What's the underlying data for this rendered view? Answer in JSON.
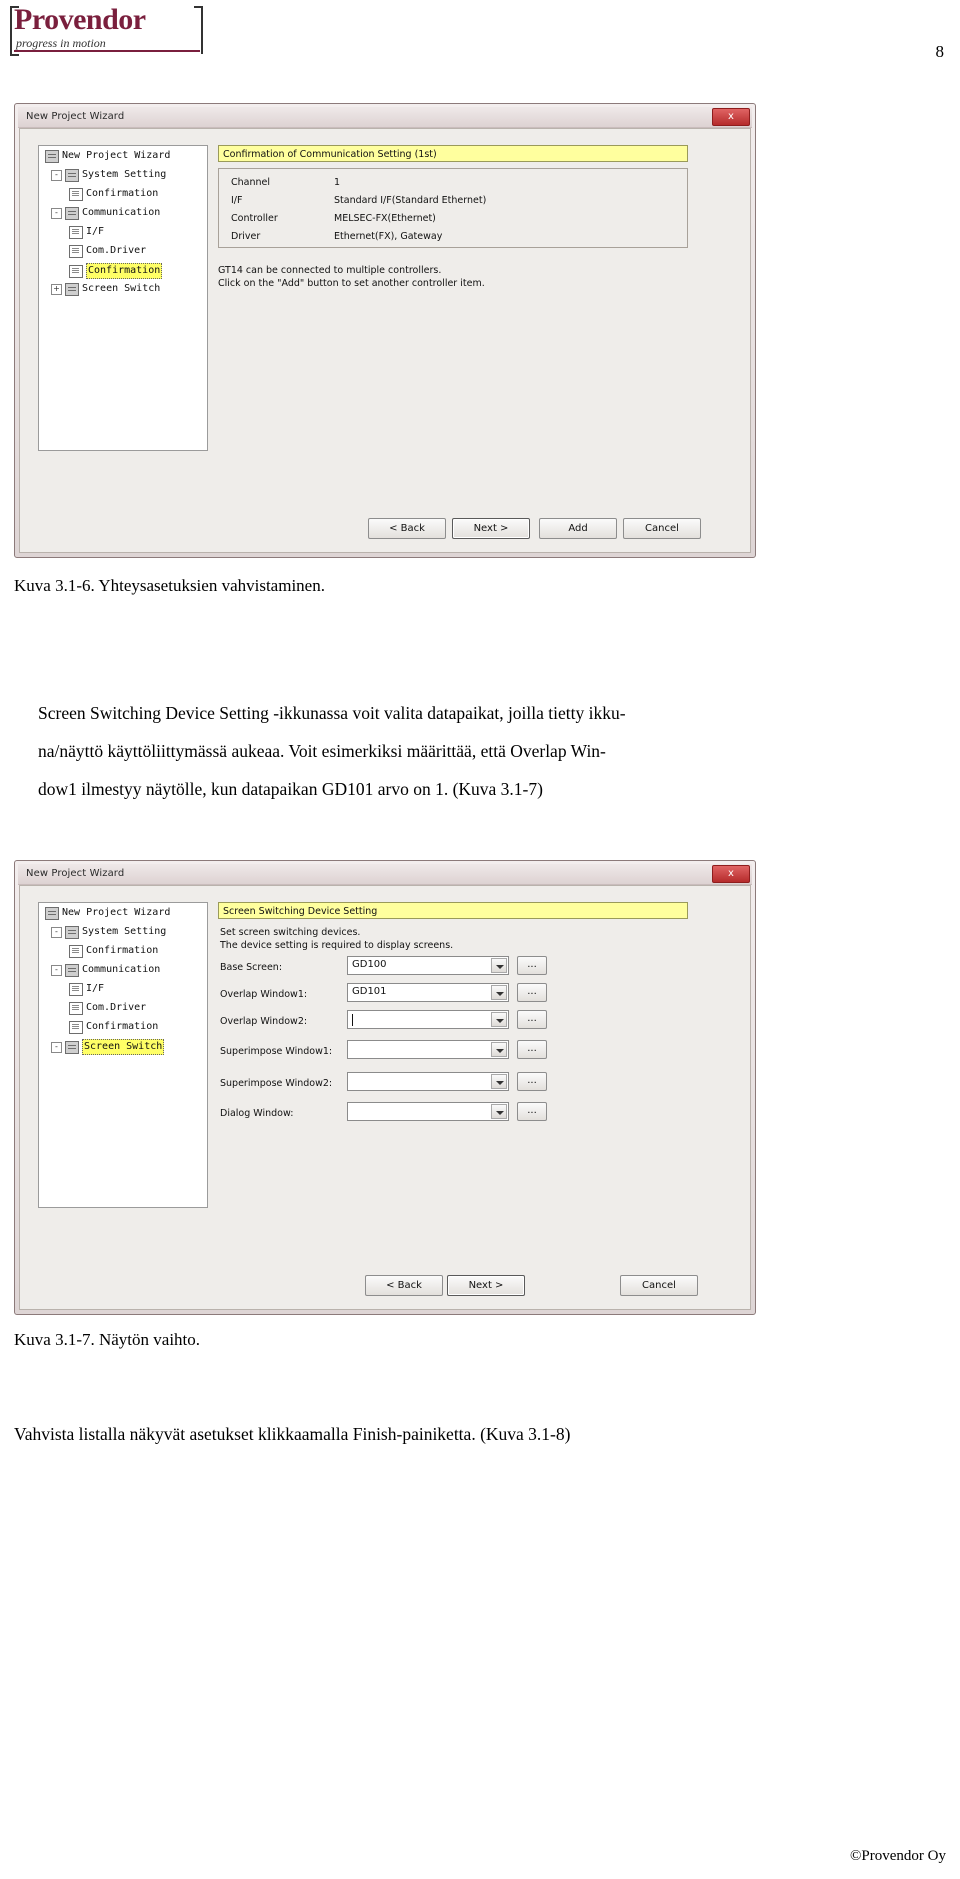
{
  "brand": {
    "name": "Provendor",
    "tagline": "progress in motion"
  },
  "page_number": "8",
  "footer": "©Provendor Oy",
  "dialog1": {
    "title": "New Project Wizard",
    "close_label": "x",
    "tree": [
      {
        "label": "New Project Wizard",
        "icon": "folder-icon",
        "indent": 0,
        "toggle": "",
        "highlight": false
      },
      {
        "label": "System Setting",
        "icon": "folder-icon",
        "indent": 1,
        "toggle": "-",
        "highlight": false
      },
      {
        "label": "Confirmation",
        "icon": "doc-icon",
        "indent": 2,
        "toggle": "",
        "highlight": false
      },
      {
        "label": "Communication",
        "icon": "folder-icon",
        "indent": 1,
        "toggle": "-",
        "highlight": false
      },
      {
        "label": "I/F",
        "icon": "doc-icon",
        "indent": 2,
        "toggle": "",
        "highlight": false
      },
      {
        "label": "Com.Driver",
        "icon": "doc-icon",
        "indent": 2,
        "toggle": "",
        "highlight": false
      },
      {
        "label": "Confirmation",
        "icon": "doc-icon",
        "indent": 2,
        "toggle": "",
        "highlight": true
      },
      {
        "label": "Screen Switch",
        "icon": "folder-icon",
        "indent": 1,
        "toggle": "+",
        "highlight": false
      }
    ],
    "banner": "Confirmation of Communication Setting (1st)",
    "rows": [
      {
        "label": "Channel",
        "value": "1"
      },
      {
        "label": "I/F",
        "value": "Standard I/F(Standard Ethernet)"
      },
      {
        "label": "Controller",
        "value": "MELSEC-FX(Ethernet)"
      },
      {
        "label": "Driver",
        "value": "Ethernet(FX), Gateway"
      }
    ],
    "note_line1": "GT14 can be connected to multiple controllers.",
    "note_line2": "Click on the \"Add\" button to set another controller item.",
    "buttons": [
      {
        "label": "< Back",
        "focus": false
      },
      {
        "label": "Next >",
        "focus": true
      },
      {
        "label": "Add",
        "focus": false
      },
      {
        "label": "Cancel",
        "focus": false
      }
    ]
  },
  "caption1": "Kuva 3.1-6. Yhteysasetuksien vahvistaminen.",
  "paragraph1_lines": [
    "Screen Switching Device Setting -ikkunassa voit valita datapaikat, joilla tietty ikku-",
    "na/näyttö käyttöliittymässä aukeaa.  Voit esimerkiksi määrittää, että Overlap Win-",
    "dow1 ilmestyy näytölle, kun datapaikan GD101 arvo on 1. (Kuva 3.1-7)"
  ],
  "dialog2": {
    "title": "New Project Wizard",
    "close_label": "x",
    "tree": [
      {
        "label": "New Project Wizard",
        "icon": "folder-icon",
        "indent": 0,
        "toggle": "",
        "highlight": false
      },
      {
        "label": "System Setting",
        "icon": "folder-icon",
        "indent": 1,
        "toggle": "-",
        "highlight": false
      },
      {
        "label": "Confirmation",
        "icon": "doc-icon",
        "indent": 2,
        "toggle": "",
        "highlight": false
      },
      {
        "label": "Communication",
        "icon": "folder-icon",
        "indent": 1,
        "toggle": "-",
        "highlight": false
      },
      {
        "label": "I/F",
        "icon": "doc-icon",
        "indent": 2,
        "toggle": "",
        "highlight": false
      },
      {
        "label": "Com.Driver",
        "icon": "doc-icon",
        "indent": 2,
        "toggle": "",
        "highlight": false
      },
      {
        "label": "Confirmation",
        "icon": "doc-icon",
        "indent": 2,
        "toggle": "",
        "highlight": false
      },
      {
        "label": "Screen Switch",
        "icon": "folder-icon",
        "indent": 1,
        "toggle": "-",
        "highlight": true
      }
    ],
    "banner": "Screen Switching Device Setting",
    "instruction_line1": "Set screen switching devices.",
    "instruction_line2": "The device setting is required to display screens.",
    "fields": [
      {
        "label": "Base Screen:",
        "value": "GD100",
        "caret": false,
        "dots": "..."
      },
      {
        "label": "Overlap Window1:",
        "value": "GD101",
        "caret": false,
        "dots": "..."
      },
      {
        "label": "Overlap Window2:",
        "value": "",
        "caret": true,
        "dots": "..."
      },
      {
        "label": "Superimpose Window1:",
        "value": "",
        "caret": false,
        "dots": "..."
      },
      {
        "label": "Superimpose Window2:",
        "value": "",
        "caret": false,
        "dots": "..."
      },
      {
        "label": "Dialog Window:",
        "value": "",
        "caret": false,
        "dots": "..."
      }
    ],
    "buttons": [
      {
        "label": "< Back",
        "focus": false
      },
      {
        "label": "Next >",
        "focus": true
      },
      {
        "label": "Cancel",
        "focus": false
      }
    ]
  },
  "caption2": "Kuva 3.1-7. Näytön vaihto.",
  "paragraph2": "Vahvista listalla näkyvät asetukset klikkaamalla Finish-painiketta. (Kuva 3.1-8)"
}
